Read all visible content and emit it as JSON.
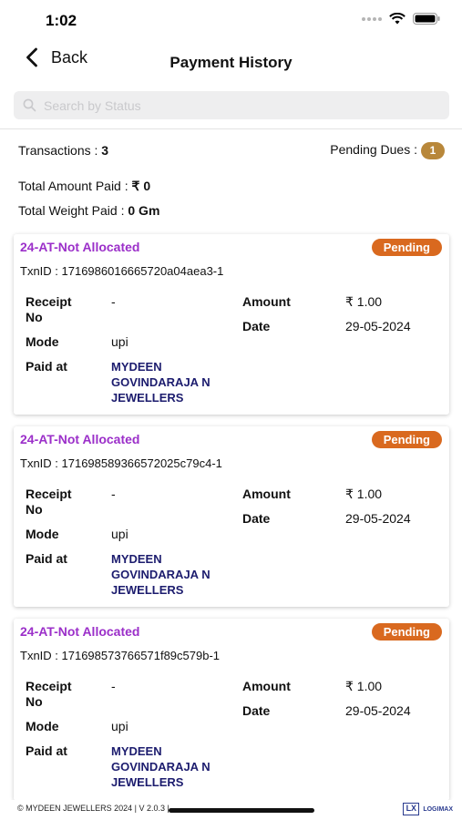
{
  "status_bar": {
    "time": "1:02"
  },
  "header": {
    "back_label": "Back",
    "title": "Payment History"
  },
  "search": {
    "placeholder": "Search by Status"
  },
  "summary": {
    "transactions_label": "Transactions : ",
    "transactions_count": "3",
    "pending_dues_label": "Pending Dues :",
    "pending_dues_count": "1",
    "total_amount_label": "Total Amount Paid : ",
    "total_amount_value": "₹ 0",
    "total_weight_label": "Total Weight Paid : ",
    "total_weight_value": "0 Gm"
  },
  "labels": {
    "receipt_no": "Receipt No",
    "amount": "Amount",
    "date": "Date",
    "mode": "Mode",
    "paid_at": "Paid at"
  },
  "transactions": [
    {
      "scheme": "24-AT-Not Allocated",
      "status": "Pending",
      "txn_id": "TxnID : 1716986016665720a04aea3-1",
      "receipt_no": "-",
      "amount": "₹  1.00",
      "date": "29-05-2024",
      "mode": "upi",
      "paid_at": "MYDEEN GOVINDARAJA N JEWELLERS"
    },
    {
      "scheme": "24-AT-Not Allocated",
      "status": "Pending",
      "txn_id": "TxnID : 171698589366572025c79c4-1",
      "receipt_no": "-",
      "amount": "₹  1.00",
      "date": "29-05-2024",
      "mode": "upi",
      "paid_at": "MYDEEN GOVINDARAJA N JEWELLERS"
    },
    {
      "scheme": "24-AT-Not Allocated",
      "status": "Pending",
      "txn_id": "TxnID : 171698573766571f89c579b-1",
      "receipt_no": "-",
      "amount": "₹  1.00",
      "date": "29-05-2024",
      "mode": "upi",
      "paid_at": "MYDEEN GOVINDARAJA N JEWELLERS"
    }
  ],
  "footer": {
    "copyright": "© MYDEEN JEWELLERS 2024 | V 2.0.3 |",
    "brand": "LOGIMAX",
    "brand_mark": "LX"
  },
  "colors": {
    "scheme": "#9b2fc9",
    "pending": "#d9691f",
    "dues_badge": "#b8873a",
    "paid_at": "#1c1c6e"
  },
  "icons": {
    "back": "chevron-left-icon",
    "search": "search-icon",
    "wifi": "wifi-icon",
    "battery": "battery-icon",
    "signal": "signal-icon"
  }
}
